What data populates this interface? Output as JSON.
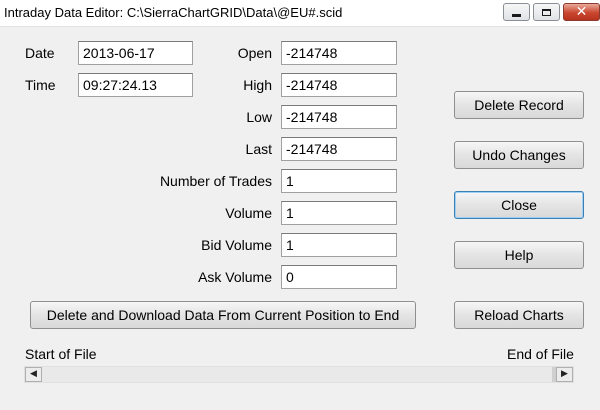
{
  "window": {
    "title": "Intraday Data Editor:  C:\\SierraChartGRID\\Data\\@EU#.scid",
    "minimize": "",
    "maximize": "",
    "close_glyph": "✕"
  },
  "fields": {
    "date": {
      "label": "Date",
      "value": "2013-06-17"
    },
    "time": {
      "label": "Time",
      "value": "09:27:24.13"
    },
    "open": {
      "label": "Open",
      "value": "-214748"
    },
    "high": {
      "label": "High",
      "value": "-214748"
    },
    "low": {
      "label": "Low",
      "value": "-214748"
    },
    "last": {
      "label": "Last",
      "value": "-214748"
    },
    "num_trades": {
      "label": "Number of Trades",
      "value": "1"
    },
    "volume": {
      "label": "Volume",
      "value": "1"
    },
    "bid_volume": {
      "label": "Bid Volume",
      "value": "1"
    },
    "ask_volume": {
      "label": "Ask Volume",
      "value": "0"
    }
  },
  "buttons": {
    "delete_record": "Delete  Record",
    "undo_changes": "Undo Changes",
    "close": "Close",
    "help": "Help",
    "reload_charts": "Reload Charts",
    "delete_download": "Delete and Download Data From Current Position to End"
  },
  "scroll": {
    "start_label": "Start of File",
    "end_label": "End of File",
    "left_arrow": "◀",
    "right_arrow": "▶",
    "position": 0.98
  }
}
